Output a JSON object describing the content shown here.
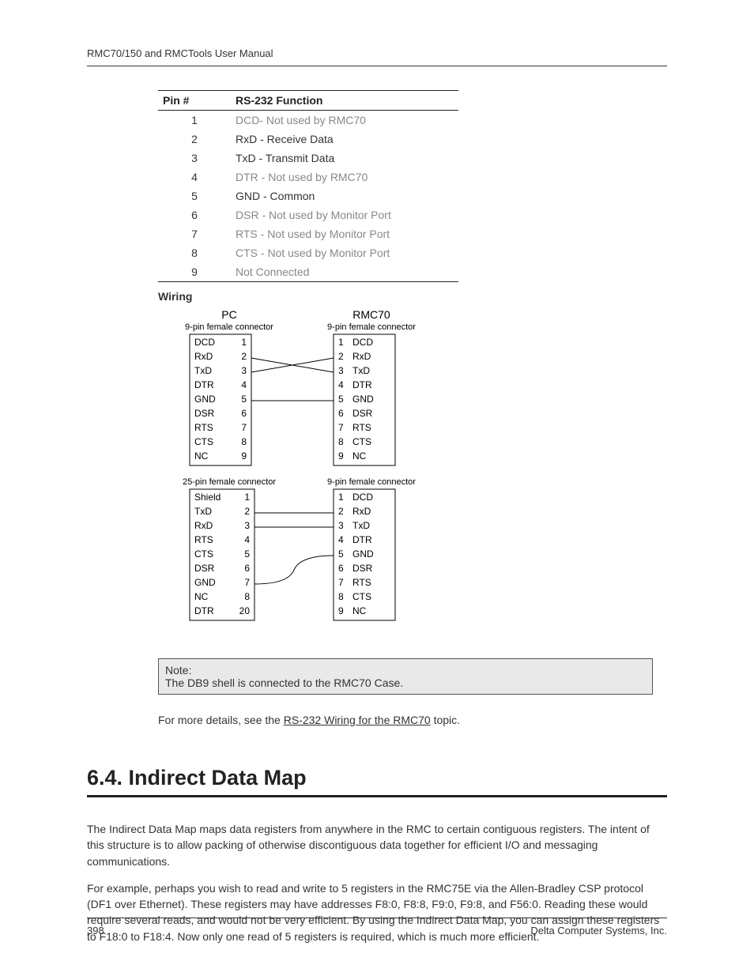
{
  "header": "RMC70/150 and RMCTools User Manual",
  "pin_table": {
    "headers": [
      "Pin #",
      "RS-232 Function"
    ],
    "rows": [
      {
        "pin": "1",
        "func": "DCD- Not used by RMC70",
        "dim": true
      },
      {
        "pin": "2",
        "func": "RxD - Receive Data",
        "dim": false
      },
      {
        "pin": "3",
        "func": "TxD - Transmit Data",
        "dim": false
      },
      {
        "pin": "4",
        "func": "DTR - Not used by RMC70",
        "dim": true
      },
      {
        "pin": "5",
        "func": "GND - Common",
        "dim": false
      },
      {
        "pin": "6",
        "func": "DSR - Not used by Monitor Port",
        "dim": true
      },
      {
        "pin": "7",
        "func": "RTS - Not used by Monitor Port",
        "dim": true
      },
      {
        "pin": "8",
        "func": "CTS - Not used by Monitor Port",
        "dim": true
      },
      {
        "pin": "9",
        "func": "Not Connected",
        "dim": true
      }
    ]
  },
  "wiring_label": "Wiring",
  "diagram": {
    "col_left_title": "PC",
    "col_right_title": "RMC70",
    "block1_sub_left": "9-pin female connector",
    "block1_sub_right": "9-pin female connector",
    "block1_left": [
      {
        "l": "DCD",
        "n": "1"
      },
      {
        "l": "RxD",
        "n": "2"
      },
      {
        "l": "TxD",
        "n": "3"
      },
      {
        "l": "DTR",
        "n": "4"
      },
      {
        "l": "GND",
        "n": "5"
      },
      {
        "l": "DSR",
        "n": "6"
      },
      {
        "l": "RTS",
        "n": "7"
      },
      {
        "l": "CTS",
        "n": "8"
      },
      {
        "l": "NC",
        "n": "9"
      }
    ],
    "block1_right": [
      {
        "n": "1",
        "l": "DCD"
      },
      {
        "n": "2",
        "l": "RxD"
      },
      {
        "n": "3",
        "l": "TxD"
      },
      {
        "n": "4",
        "l": "DTR"
      },
      {
        "n": "5",
        "l": "GND"
      },
      {
        "n": "6",
        "l": "DSR"
      },
      {
        "n": "7",
        "l": "RTS"
      },
      {
        "n": "8",
        "l": "CTS"
      },
      {
        "n": "9",
        "l": "NC"
      }
    ],
    "block2_sub_left": "25-pin female connector",
    "block2_sub_right": "9-pin female connector",
    "block2_left": [
      {
        "l": "Shield",
        "n": "1"
      },
      {
        "l": "TxD",
        "n": "2"
      },
      {
        "l": "RxD",
        "n": "3"
      },
      {
        "l": "RTS",
        "n": "4"
      },
      {
        "l": "CTS",
        "n": "5"
      },
      {
        "l": "DSR",
        "n": "6"
      },
      {
        "l": "GND",
        "n": "7"
      },
      {
        "l": "NC",
        "n": "8"
      },
      {
        "l": "DTR",
        "n": "20"
      }
    ],
    "block2_right": [
      {
        "n": "1",
        "l": "DCD"
      },
      {
        "n": "2",
        "l": "RxD"
      },
      {
        "n": "3",
        "l": "TxD"
      },
      {
        "n": "4",
        "l": "DTR"
      },
      {
        "n": "5",
        "l": "GND"
      },
      {
        "n": "6",
        "l": "DSR"
      },
      {
        "n": "7",
        "l": "RTS"
      },
      {
        "n": "8",
        "l": "CTS"
      },
      {
        "n": "9",
        "l": "NC"
      }
    ]
  },
  "note": {
    "title": "Note:",
    "text": "The DB9 shell is connected to the RMC70 Case."
  },
  "followup": {
    "pre": "For more details, see the ",
    "link": "RS-232 Wiring for the RMC70",
    "post": " topic."
  },
  "heading": "6.4. Indirect Data Map",
  "para1": "The Indirect Data Map maps data registers from anywhere in the RMC to certain contiguous registers. The intent of this structure is to allow packing of otherwise discontiguous data together for efficient I/O and messaging communications.",
  "para2": "For example, perhaps you wish to read and write to 5 registers in the RMC75E via the Allen-Bradley CSP protocol (DF1 over Ethernet). These registers may have addresses F8:0, F8:8, F9:0, F9:8, and F56:0. Reading these would require several reads, and would not be very efficient. By using the Indirect Data Map, you can assign these registers to F18:0 to F18:4. Now only one read of 5 registers is required, which is much more efficient.",
  "footer": {
    "page": "398",
    "company": "Delta Computer Systems, Inc."
  }
}
